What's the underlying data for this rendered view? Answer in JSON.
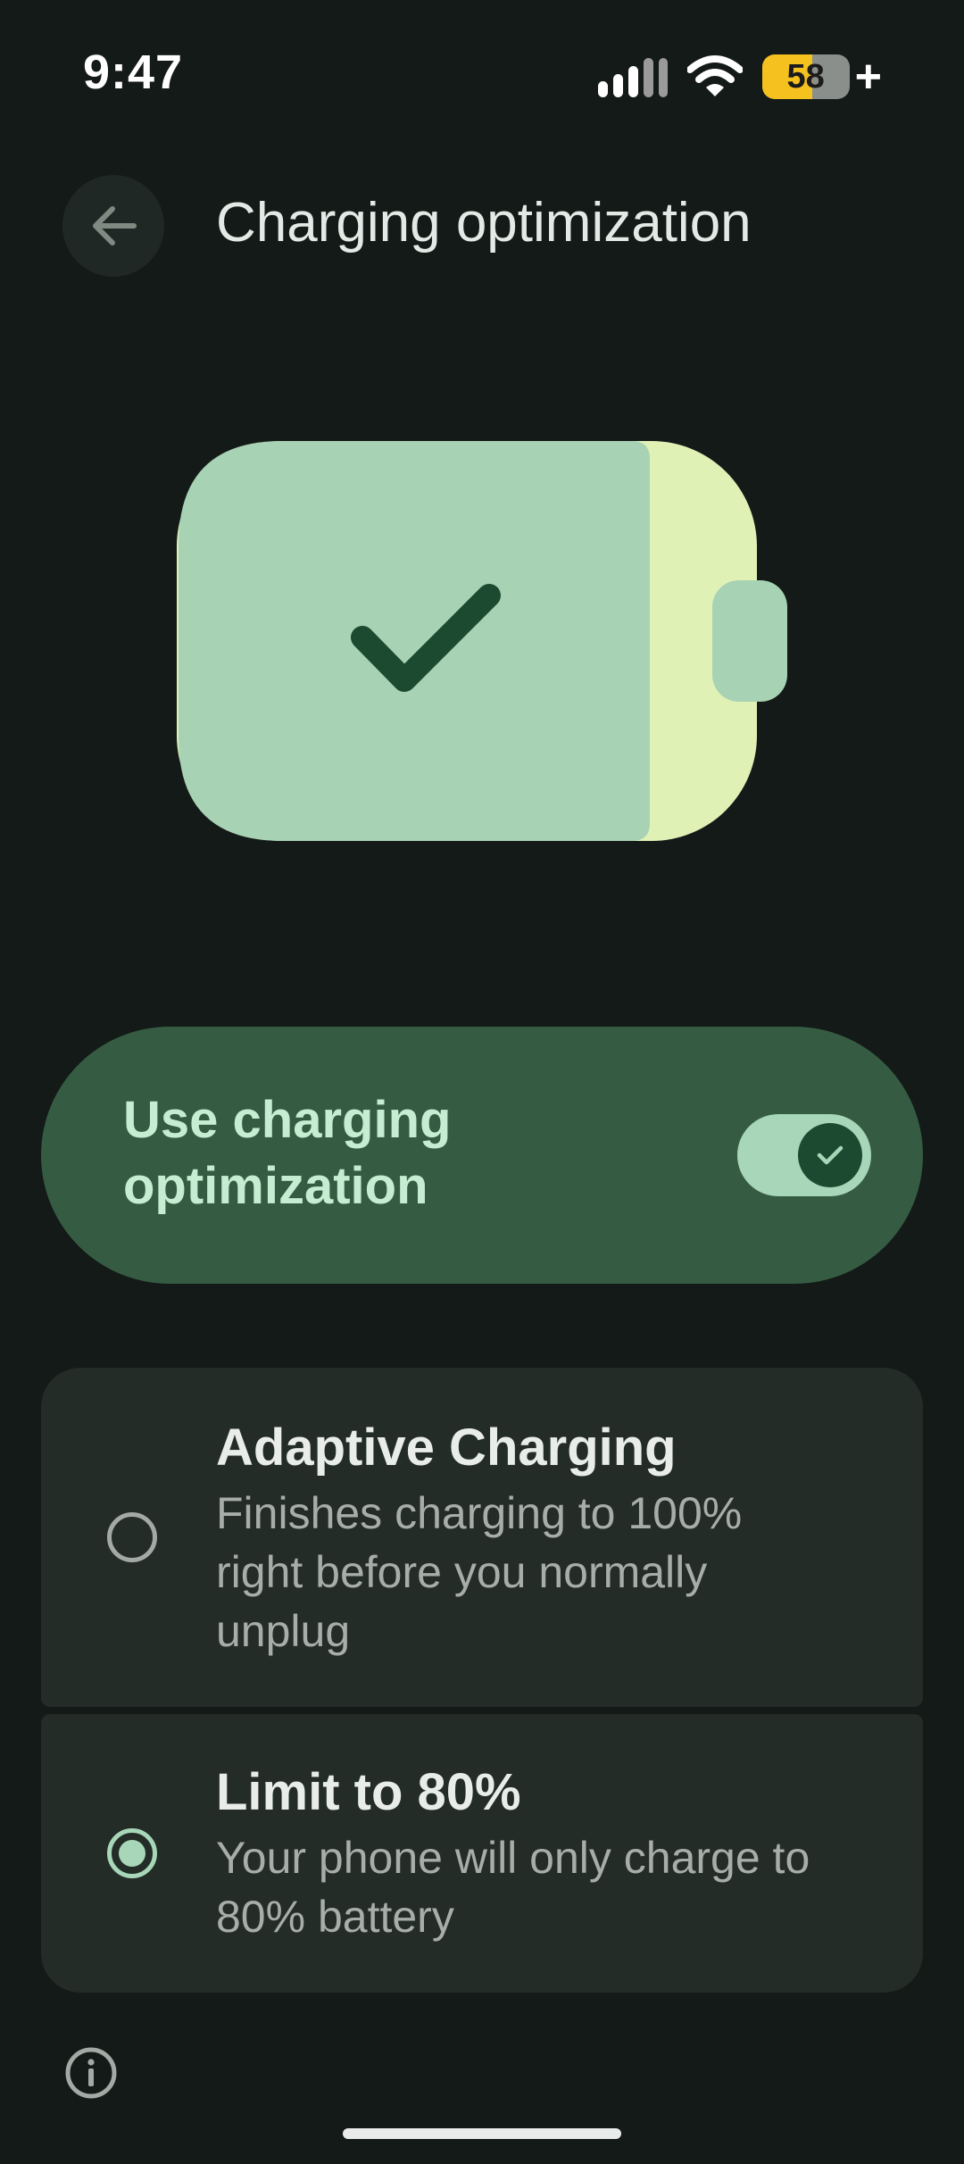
{
  "status_bar": {
    "time": "9:47",
    "battery_percent": "58",
    "battery_level": 0.58,
    "plus": "+",
    "icons": [
      "signal-icon",
      "wifi-icon",
      "battery-icon",
      "plus-icon"
    ]
  },
  "header": {
    "back_icon": "arrow-back-icon",
    "title": "Charging optimization"
  },
  "illustration": {
    "icon": "battery-check-icon",
    "colors": {
      "battery_fill": "#a8d2b4",
      "battery_case": "#e0f1b6",
      "check": "#1c4a30"
    }
  },
  "main_toggle": {
    "label": "Use charging optimization",
    "checked": true
  },
  "options": [
    {
      "title": "Adaptive Charging",
      "description": "Finishes charging to 100% right before you normally unplug",
      "selected": false
    },
    {
      "title": "Limit to 80%",
      "description": "Your phone will only charge to 80% battery",
      "selected": true
    }
  ],
  "footer": {
    "info_icon": "info-icon"
  },
  "colors": {
    "background": "#141a17",
    "accent": "#a8d6b8",
    "toggle_card": "#355c43",
    "option_card": "#232c27"
  }
}
